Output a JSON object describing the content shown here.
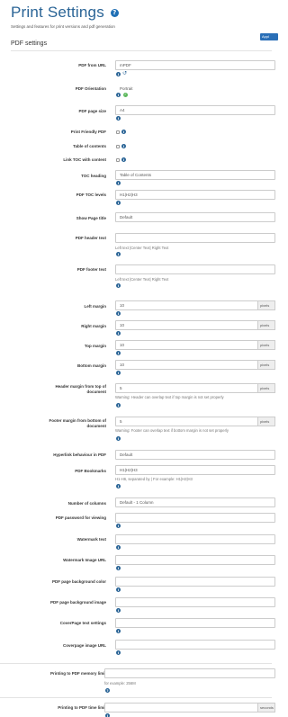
{
  "header": {
    "title": "Print Settings",
    "title_icon": "?",
    "subtitle": "Settings and features for print versions and pdf generation",
    "apply_label": "Appl",
    "section_title": "PDF settings"
  },
  "icons": {
    "info": "i",
    "check": "✓",
    "reset": "↺",
    "question": "?"
  },
  "labels": {
    "pdf_from_url": "PDF from URL",
    "pdf_orientation": "PDF Orientation",
    "pdf_page_size": "PDF page size",
    "print_friendly_pdf": "Print Friendly PDF",
    "table_of_contents": "Table of contents",
    "link_toc": "Link TOC with content",
    "toc_heading": "TOC heading",
    "pdf_toc_levels": "PDF TOC levels",
    "show_page_title": "Show Page title",
    "pdf_header_text": "PDF header text",
    "pdf_footer_text": "PDF footer text",
    "left_margin": "Left margin",
    "right_margin": "Right margin",
    "top_margin": "Top margin",
    "bottom_margin": "Bottom margin",
    "header_margin_line1": "Header margin from top of",
    "header_margin_line2": "document",
    "footer_margin_line1": "Footer margin from bottom of",
    "footer_margin_line2": "document",
    "hyperlink_behaviour": "Hyperlink behaviour in PDF",
    "pdf_bookmarks": "PDF Bookmarks",
    "number_of_columns": "Number of columns",
    "pdf_password": "PDF password for viewing",
    "watermark_text": "Watermark text",
    "watermark_image_url": "Watermark Image URL",
    "pdf_bg_color": "PDF page background color",
    "pdf_bg_image": "PDF page background image",
    "coverpage_text_settings": "CoverPage text settings",
    "coverpage_image_url": "Coverpage image URL",
    "memory_limit": "Printing to PDF memory limit",
    "time_limit": "Printing to PDF time limit"
  },
  "values": {
    "pdf_from_url": "mPDF",
    "pdf_orientation": "Portrait",
    "pdf_page_size": "A4",
    "toc_heading": "Table of Contents",
    "pdf_toc_levels": "H1|H2|H3",
    "show_page_title": "Default",
    "left_margin": "10",
    "right_margin": "10",
    "top_margin": "10",
    "bottom_margin": "10",
    "header_margin": "5",
    "footer_margin": "5",
    "hyperlink_behaviour": "Default",
    "pdf_bookmarks": "H1|H2|H3",
    "number_of_columns": "Default - 1 Column",
    "pdf_password": "",
    "watermark_text": "",
    "watermark_image_url": "",
    "pdf_bg_color": "",
    "pdf_bg_image": "",
    "coverpage_text_settings": "",
    "coverpage_image_url": "",
    "memory_limit": "",
    "time_limit": "",
    "pdf_header_text": "",
    "pdf_footer_text": ""
  },
  "units": {
    "pixels": "pixels",
    "seconds": "seconds"
  },
  "hints": {
    "header_text": "Left text |Center Text| Right Text",
    "footer_text": "Left text |Center Text| Right Text",
    "header_margin_warning": "Warning: Header can overlap text if top margin is not set properly",
    "footer_margin_warning": "Warning: Footer can overlap text if bottom margin is not set properly",
    "bookmarks": "H1-H6, separated by | For example: H1|H2|H3",
    "memory_limit": "for example: 256M"
  },
  "colors": {
    "accent": "#2a6496",
    "success": "#5cb85c",
    "button": "#2a6fb7"
  }
}
